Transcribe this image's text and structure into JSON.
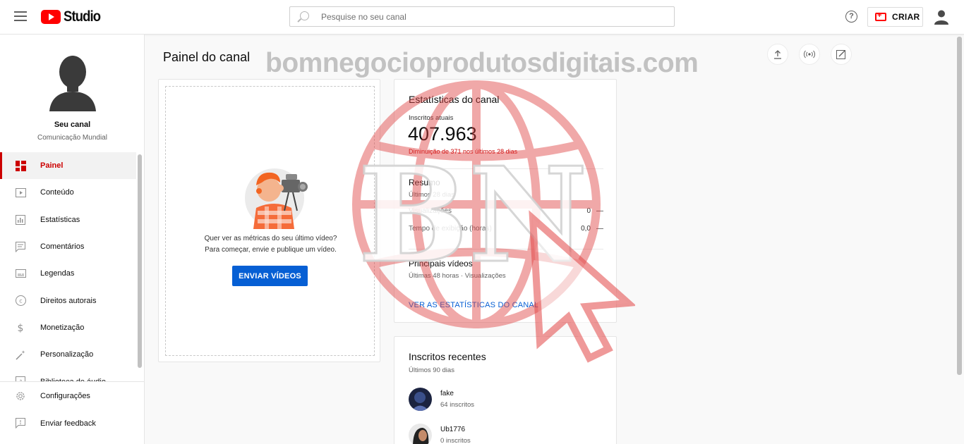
{
  "header": {
    "logo_text": "Studio",
    "search_placeholder": "Pesquise no seu canal",
    "help_symbol": "?",
    "create_label": "CRIAR"
  },
  "sidebar": {
    "channel_title": "Seu canal",
    "channel_name": "Comunicação Mundial",
    "items": [
      {
        "label": "Painel",
        "icon": "dashboard-icon",
        "active": true
      },
      {
        "label": "Conteúdo",
        "icon": "video-icon"
      },
      {
        "label": "Estatísticas",
        "icon": "analytics-icon"
      },
      {
        "label": "Comentários",
        "icon": "comments-icon"
      },
      {
        "label": "Legendas",
        "icon": "subtitles-icon"
      },
      {
        "label": "Direitos autorais",
        "icon": "copyright-icon"
      },
      {
        "label": "Monetização",
        "icon": "dollar-icon"
      },
      {
        "label": "Personalização",
        "icon": "magic-wand-icon"
      },
      {
        "label": "Biblioteca de áudio",
        "icon": "audio-library-icon"
      }
    ],
    "bottom_items": [
      {
        "label": "Configurações",
        "icon": "gear-icon"
      },
      {
        "label": "Enviar feedback",
        "icon": "feedback-icon"
      }
    ]
  },
  "main": {
    "page_title": "Painel do canal",
    "upload_card": {
      "prompt_line1": "Quer ver as métricas do seu último vídeo?",
      "prompt_line2": "Para começar, envie e publique um vídeo.",
      "button_label": "ENVIAR VÍDEOS"
    },
    "stats_card": {
      "title": "Estatísticas do canal",
      "current_subs_label": "Inscritos atuais",
      "current_subs_value": "407.963",
      "change_text": "Diminuição de 371 nos últimos 28 dias",
      "summary_title": "Resumo",
      "summary_period": "Últimos 28 dias",
      "metrics": [
        {
          "label": "Visualizações",
          "value": "0",
          "trend": "—"
        },
        {
          "label": "Tempo de exibição (horas)",
          "value": "0,0",
          "trend": "—"
        }
      ],
      "top_videos_title": "Principais vídeos",
      "top_videos_period": "Últimas 48 horas · Visualizações",
      "link_label": "VER AS ESTATÍSTICAS DO CANAL"
    },
    "subs_card": {
      "title": "Inscritos recentes",
      "period": "Últimos 90 dias",
      "subscribers": [
        {
          "name": "fake",
          "count": "64 inscritos"
        },
        {
          "name": "Ub1776",
          "count": "0 inscritos"
        }
      ]
    }
  },
  "watermark": {
    "text": "bomnegocioprodutosdigitais.com",
    "logo_letters": "BN"
  },
  "colors": {
    "brand_red": "#ff0000",
    "active_red": "#cc0000",
    "link_blue": "#065fd4"
  }
}
